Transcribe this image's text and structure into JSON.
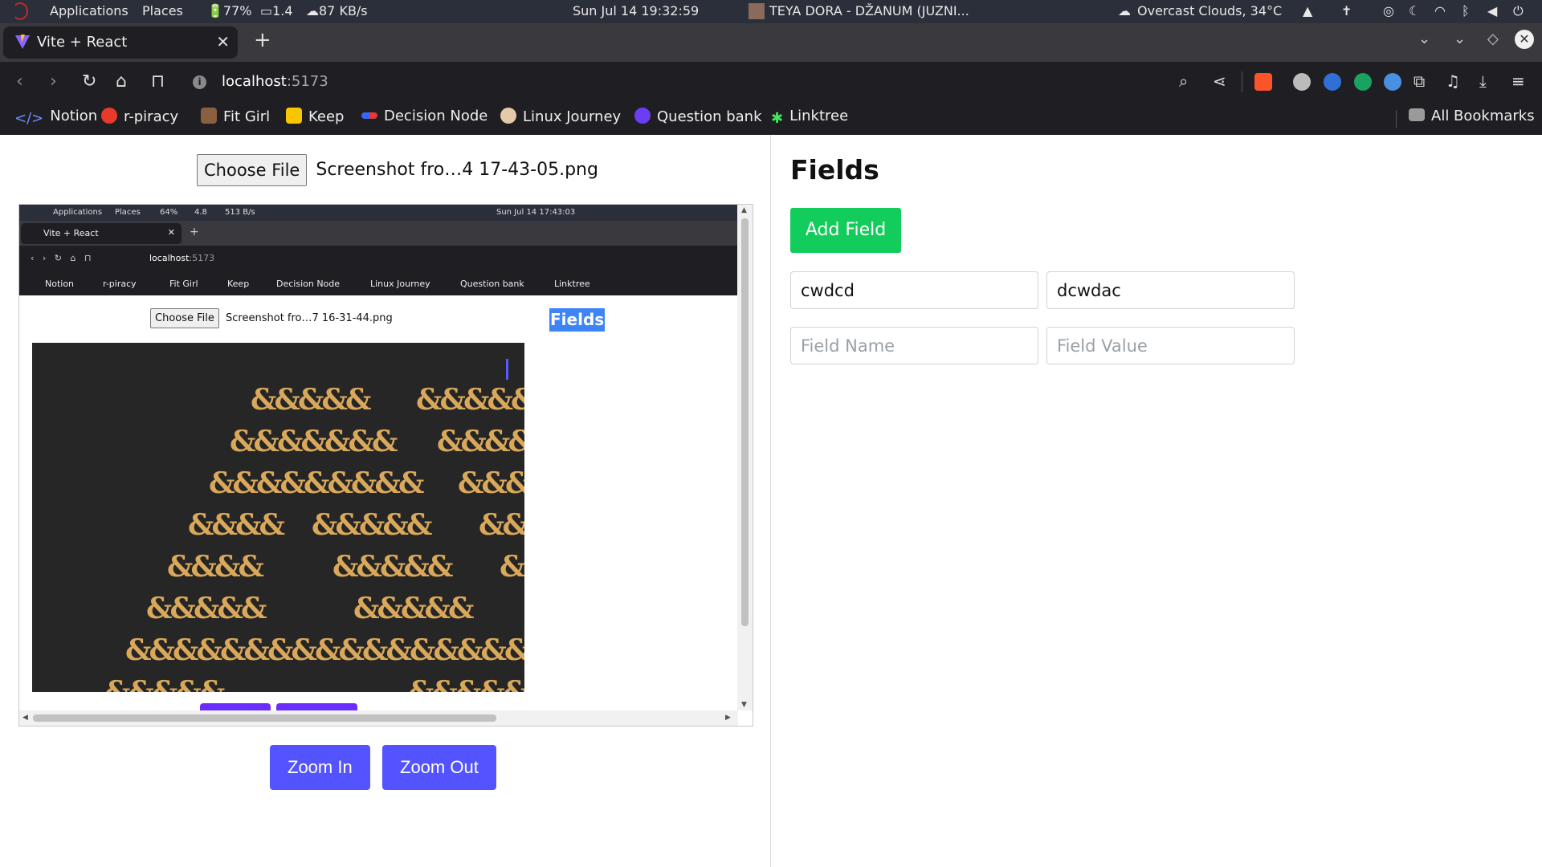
{
  "system_bar": {
    "applications": "Applications",
    "places": "Places",
    "battery": "77%",
    "load": "1.4",
    "network": "87 KB/s",
    "datetime": "Sun Jul 14  19:32:59",
    "now_playing": "TEYA DORA - DŽANUM (JUZNI...",
    "weather": "Overcast Clouds, 34°C"
  },
  "browser": {
    "tab_title": "Vite + React",
    "url_host": "localhost",
    "url_port": ":5173",
    "bookmarks": [
      "Notion",
      "r-piracy",
      "Fit Girl",
      "Keep",
      "Decision Node",
      "Linux Journey",
      "Question bank",
      "Linktree"
    ],
    "all_bookmarks": "All Bookmarks"
  },
  "left": {
    "choose_file": "Choose File",
    "file_name": "Screenshot fro…4 17-43-05.png",
    "zoom_in": "Zoom In",
    "zoom_out": "Zoom Out"
  },
  "preview": {
    "applications": "Applications",
    "places": "Places",
    "battery": "64%",
    "load": "4.8",
    "network": "513 B/s",
    "datetime": "Sun Jul 14  17:43:03",
    "tab_title": "Vite + React",
    "url_host": "localhost",
    "url_port": ":5173",
    "bookmarks": [
      "Notion",
      "r-piracy",
      "Fit Girl",
      "Keep",
      "Decision Node",
      "Linux Journey",
      "Question bank",
      "Linktree"
    ],
    "choose_file": "Choose File",
    "file_name": "Screenshot fro…7 16-31-44.png",
    "fields_label": "Fields",
    "amp_rows": [
      "&&&&&",
      "&&&&&&&",
      "&&&&&&&&&",
      "&&&&",
      "&&&&",
      "&&&&&",
      "&&&&&&&&&&&&&&&&&",
      "&&&&&",
      "&&&&&",
      "&&&&",
      "&&&&",
      "&&&&&",
      "&&&&&",
      "&&&",
      "&&&&&",
      "&&&&&",
      "&&"
    ]
  },
  "right": {
    "title": "Fields",
    "add_field": "Add Field",
    "fields": [
      {
        "name": "cwdcd",
        "value": "dcwdac"
      }
    ],
    "new_field": {
      "name_placeholder": "Field Name",
      "value_placeholder": "Field Value"
    }
  },
  "colors": {
    "zoom_button": "#5353ff",
    "add_button": "#12cc5b",
    "highlight": "#3d84f7"
  }
}
